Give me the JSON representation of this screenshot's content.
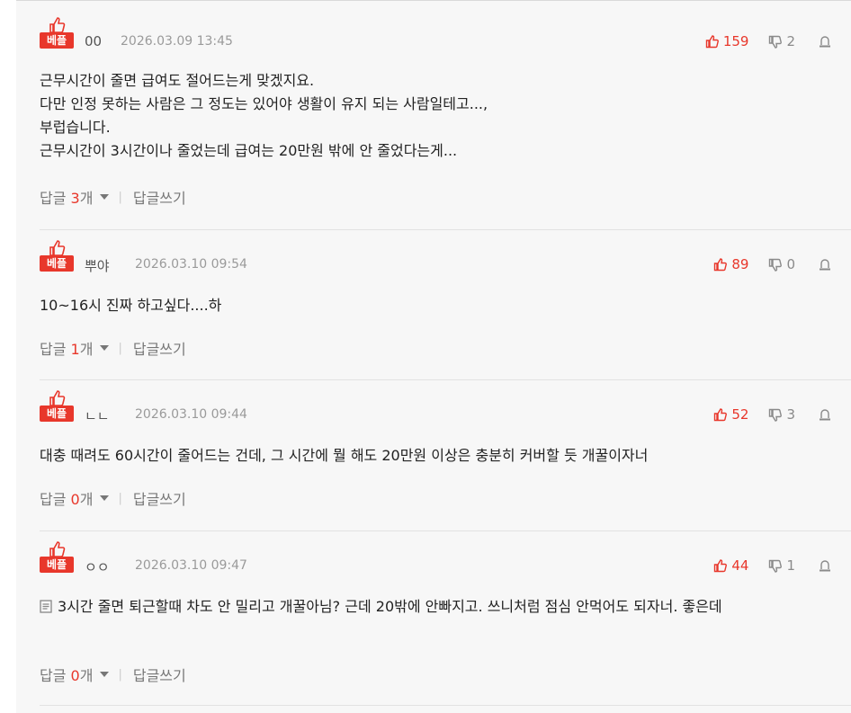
{
  "comments": [
    {
      "badge": "베플",
      "nick": "00",
      "date": "2026.03.09 13:45",
      "up": "159",
      "down": "2",
      "lines": [
        "근무시간이 줄면 급여도 절어드는게 맞겠지요.",
        "다만 인정 못하는 사람은 그 정도는 있어야 생활이 유지 되는 사람일테고...,",
        "부럽습니다.",
        "근무시간이 3시간이나 줄었는데 급여는 20만원 밖에 안 줄었다는게..."
      ],
      "reply_label": "답글",
      "reply_count": "3",
      "reply_unit": "개",
      "write_label": "답글쓰기"
    },
    {
      "badge": "베플",
      "nick": "뿌야",
      "date": "2026.03.10 09:54",
      "up": "89",
      "down": "0",
      "lines": [
        "10~16시 진짜 하고싶다....하"
      ],
      "reply_label": "답글",
      "reply_count": "1",
      "reply_unit": "개",
      "write_label": "답글쓰기"
    },
    {
      "badge": "베플",
      "nick": "ㄴㄴ",
      "date": "2026.03.10 09:44",
      "up": "52",
      "down": "3",
      "lines": [
        "대충 때려도 60시간이 줄어드는 건데, 그 시간에 뭘 해도 20만원 이상은 충분히 커버할 듯 개꿀이자너"
      ],
      "reply_label": "답글",
      "reply_count": "0",
      "reply_unit": "개",
      "write_label": "답글쓰기"
    },
    {
      "badge": "베플",
      "nick": "ㅇㅇ",
      "date": "2026.03.10 09:47",
      "up": "44",
      "down": "1",
      "text": "3시간 줄면 퇴근할때 차도 안 밀리고 개꿀아님? 근데 20밖에 안빠지고. 쓰니처럼 점심 안먹어도 되자너. 좋은데",
      "reply_label": "답글",
      "reply_count": "0",
      "reply_unit": "개",
      "write_label": "답글쓰기"
    }
  ],
  "colors": {
    "accent": "#e8372b",
    "muted": "#9a9a9a",
    "panel": "#f7f7f7"
  },
  "icons": [
    "thumbs-up-icon",
    "thumbs-down-icon",
    "report-icon",
    "chevron-down-icon",
    "memo-icon"
  ]
}
